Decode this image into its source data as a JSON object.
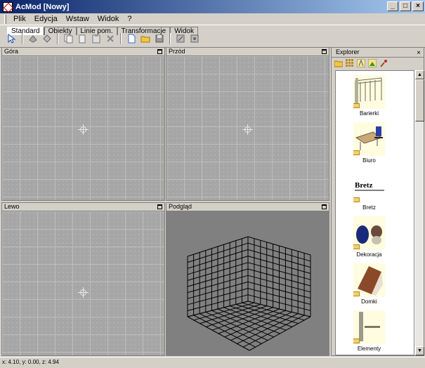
{
  "window": {
    "title": "AcMod [Nowy]",
    "minimize": "_",
    "maximize": "□",
    "close": "×"
  },
  "menu": {
    "items": [
      "Plik",
      "Edycja",
      "Wstaw",
      "Widok",
      "?"
    ]
  },
  "tabs": [
    "Standard",
    "Obiekty",
    "Linie pom.",
    "Transformacje",
    "Widok"
  ],
  "toolbar": {
    "icons": [
      "cursor-icon",
      "tool-a-icon",
      "tool-b-icon",
      "copy-icon",
      "paste-icon",
      "clipboard-icon",
      "delete-icon",
      "new-file-icon",
      "open-folder-icon",
      "save-icon",
      "render-icon",
      "export-icon"
    ]
  },
  "viewports": {
    "top": "Góra",
    "front": "Przód",
    "left": "Lewo",
    "preview": "Podgląd"
  },
  "explorer": {
    "title": "Explorer",
    "close": "×",
    "items": [
      {
        "label": "Barierki",
        "icon": "railing-icon"
      },
      {
        "label": "Biuro",
        "icon": "office-desk-icon"
      },
      {
        "label": "Bretz",
        "icon": "bretz-logo-icon"
      },
      {
        "label": "Dekoracja",
        "icon": "decoration-vase-icon"
      },
      {
        "label": "Domki",
        "icon": "house-icon"
      },
      {
        "label": "Elementy",
        "icon": "element-icon"
      }
    ]
  },
  "status": {
    "coords": "x: 4.10, y: 0.00, z: 4.94"
  }
}
